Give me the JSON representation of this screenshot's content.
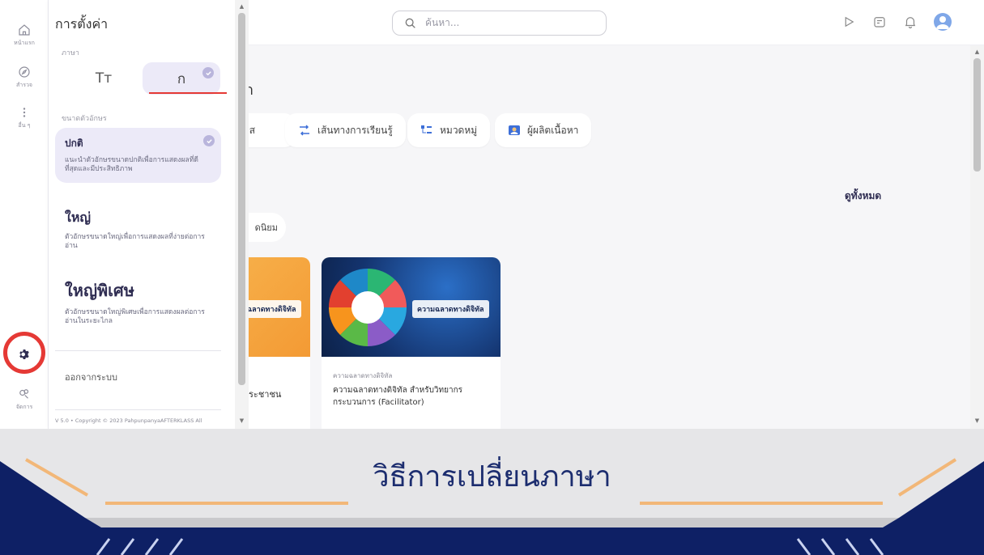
{
  "rail": {
    "items": [
      {
        "label": "หน้าแรก",
        "icon": "home-icon"
      },
      {
        "label": "สำรวจ",
        "icon": "compass-icon"
      },
      {
        "label": "อื่น ๆ",
        "icon": "more-icon"
      },
      {
        "label": "จัดการ",
        "icon": "manage-icon"
      }
    ]
  },
  "settings": {
    "title": "การตั้งค่า",
    "language_label": "ภาษา",
    "languages": [
      {
        "glyph": "Tт",
        "selected": false
      },
      {
        "glyph": "ก",
        "selected": true
      }
    ],
    "font_size_label": "ขนาดตัวอักษร",
    "sizes": [
      {
        "title": "ปกติ",
        "desc": "แนะนำตัวอักษรขนาดปกติเพื่อการแสดงผลที่ดีที่สุดและมีประสิทธิภาพ",
        "selected": true
      },
      {
        "title": "ใหญ่",
        "desc": "ตัวอักษรขนาดใหญ่เพื่อการแสดงผลที่ง่ายต่อการอ่าน",
        "selected": false
      },
      {
        "title": "ใหญ่พิเศษ",
        "desc": "ตัวอักษรขนาดใหญ่พิเศษเพื่อการแสดงผลต่อการอ่านในระยะไกล",
        "selected": false
      }
    ],
    "logout": "ออกจากระบบ",
    "copyright": "V 5.0 • Copyright © 2023 PahpunpanyaAFTERKLASS All"
  },
  "topbar": {
    "search_placeholder": "ค้นหา..."
  },
  "main": {
    "heading": "า",
    "chips": [
      {
        "label": "าส",
        "icon": ""
      },
      {
        "label": "เส้นทางการเรียนรู้",
        "icon": "path-icon"
      },
      {
        "label": "หมวดหมู่",
        "icon": "category-icon"
      },
      {
        "label": "ผู้ผลิตเนื้อหา",
        "icon": "creator-icon"
      }
    ],
    "see_all": "ดูทั้งหมด",
    "popular": "ดนิยม",
    "cards": [
      {
        "tag": "ฉลาดทางดิจิทัล",
        "title": "ระชาชน"
      },
      {
        "tag": "ความฉลาดทางดิจิทัล",
        "category": "ความฉลาดทางดิจิทัล",
        "title": "ความฉลาดทางดิจิทัล สำหรับวิทยากรกระบวนการ (Facilitator)"
      }
    ]
  },
  "banner": {
    "title": "วิธีการเปลี่ยนภาษา"
  },
  "colors": {
    "accent": "#2f2d52",
    "highlight": "#e53935",
    "banner_navy": "#0e2065",
    "orange": "#f39a34"
  }
}
